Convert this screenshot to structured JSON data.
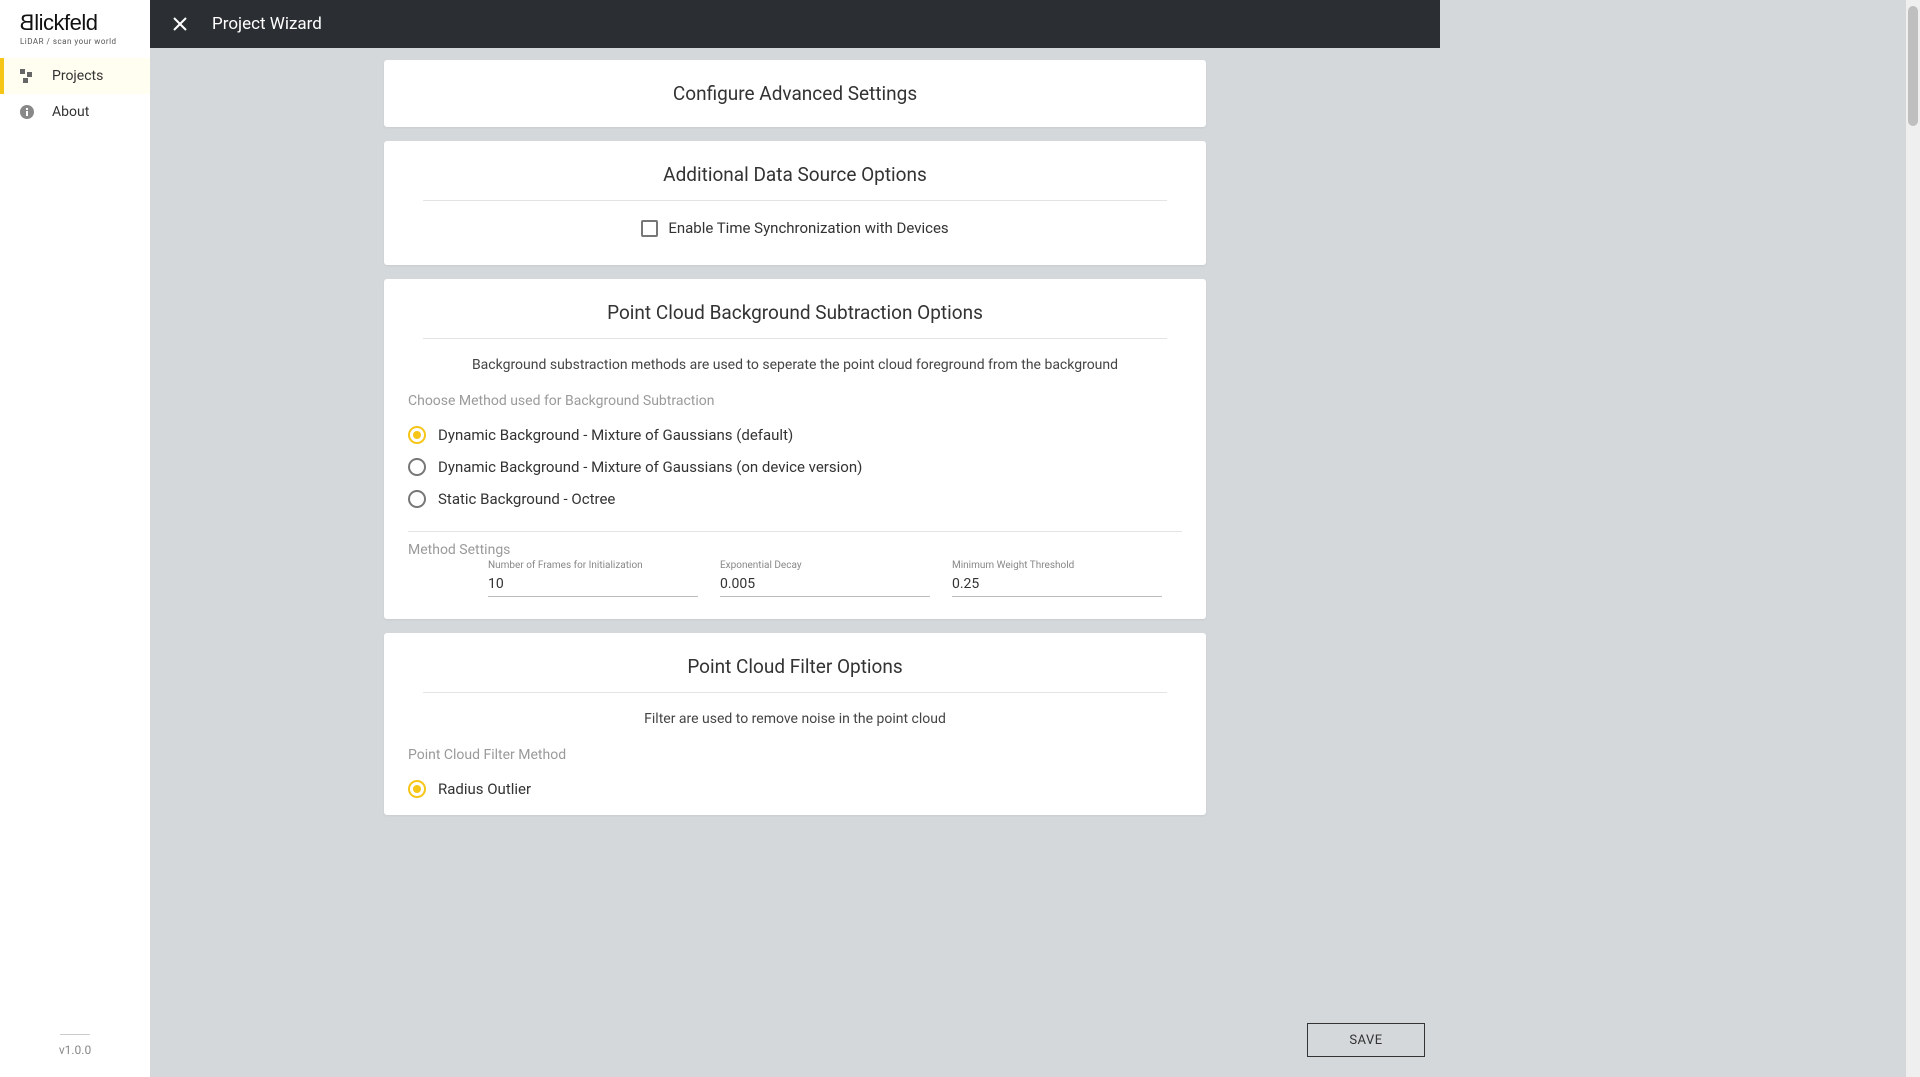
{
  "branding": {
    "logo_main": "Blickfeld",
    "logo_sub": "LiDAR / scan your world"
  },
  "sidebar": {
    "items": [
      {
        "label": "Projects",
        "active": true
      },
      {
        "label": "About",
        "active": false
      }
    ],
    "version": "v1.0.0"
  },
  "topbar": {
    "title": "Project Wizard"
  },
  "cards": {
    "advanced_title": "Configure Advanced Settings",
    "additional": {
      "title": "Additional Data Source Options",
      "checkbox_label": "Enable Time Synchronization with Devices",
      "checked": false
    },
    "bg_subtraction": {
      "title": "Point Cloud Background Subtraction Options",
      "desc": "Background substraction methods are used to seperate the point cloud foreground from the background",
      "method_group_label": "Choose Method used for Background Subtraction",
      "methods": [
        {
          "label": "Dynamic Background - Mixture of Gaussians (default)",
          "selected": true
        },
        {
          "label": "Dynamic Background - Mixture of Gaussians (on device version)",
          "selected": false
        },
        {
          "label": "Static Background - Octree",
          "selected": false
        }
      ],
      "settings_label": "Method Settings",
      "fields": [
        {
          "label": "Number of Frames for Initialization",
          "value": "10"
        },
        {
          "label": "Exponential Decay",
          "value": "0.005"
        },
        {
          "label": "Minimum Weight Threshold",
          "value": "0.25"
        }
      ]
    },
    "filter": {
      "title": "Point Cloud Filter Options",
      "desc": "Filter are used to remove noise in the point cloud",
      "method_group_label": "Point Cloud Filter Method",
      "methods": [
        {
          "label": "Radius Outlier",
          "selected": true
        }
      ]
    }
  },
  "buttons": {
    "save": "SAVE"
  }
}
